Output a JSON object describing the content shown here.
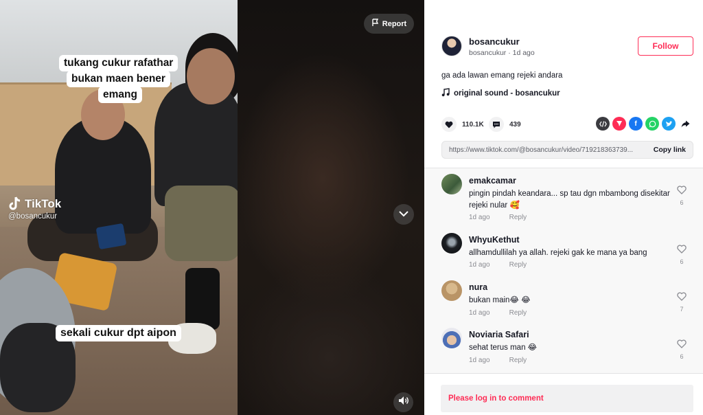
{
  "video": {
    "captions": {
      "top_line1": "tukang cukur rafathar",
      "top_line2": "bukan maen bener",
      "top_line3": "emang",
      "bottom": "sekali cukur dpt aipon"
    },
    "watermark": {
      "brand": "TikTok",
      "handle": "@bosancukur"
    },
    "report_label": "Report"
  },
  "post": {
    "author": "bosancukur",
    "author_sub": "bosancukur · 1d ago",
    "follow_label": "Follow",
    "description": "ga ada lawan emang rejeki andara",
    "music": "original sound - bosancukur",
    "likes": "110.1K",
    "comments_count": "439",
    "url": "https://www.tiktok.com/@bosancukur/video/719218363739...",
    "copy_label": "Copy link"
  },
  "comments": [
    {
      "user": "emakcamar",
      "text": "pingin pindah keandara... sp tau dgn mbambong disekitar rejeki nular 🥰",
      "time": "1d ago",
      "reply": "Reply",
      "likes": "6"
    },
    {
      "user": "WhyuKethut",
      "text": "allhamdullilah ya allah. rejeki gak ke mana ya bang",
      "time": "1d ago",
      "reply": "Reply",
      "likes": "6"
    },
    {
      "user": "nura",
      "text": "bukan main😂 😂",
      "time": "1d ago",
      "reply": "Reply",
      "likes": "7"
    },
    {
      "user": "Noviaria Safari",
      "text": "sehat terus man 😂",
      "time": "1d ago",
      "reply": "Reply",
      "likes": "6"
    }
  ],
  "login_prompt": "Please log in to comment",
  "colors": {
    "accent": "#fe2c55",
    "text": "#161823",
    "muted": "#8a8b91"
  }
}
